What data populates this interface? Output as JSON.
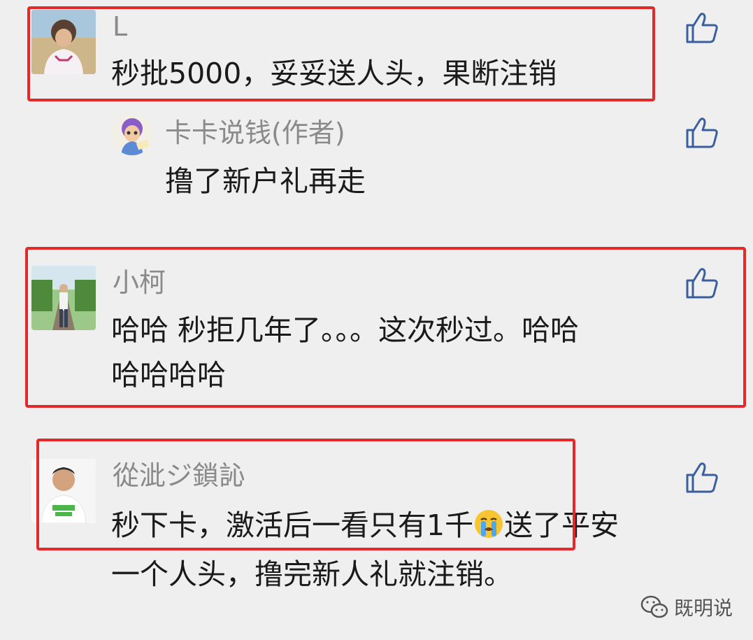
{
  "comments": [
    {
      "author": "L",
      "lines": [
        "秒批5000，妥妥送人头，果断注销"
      ],
      "highlighted": true
    },
    {
      "author": "卡卡说钱(作者)",
      "lines": [
        "撸了新户礼再走"
      ],
      "highlighted": false,
      "is_reply": true
    },
    {
      "author": "小柯",
      "lines": [
        "哈哈 秒拒几年了。。。这次秒过。哈哈",
        "哈哈哈哈"
      ],
      "highlighted": true
    },
    {
      "author": "從泚ジ鎖訫",
      "line1_before_emoji": "秒下卡，激活后一看只有1千",
      "line1_after_emoji": "送了平安",
      "line2": "一个人头，撸完新人礼就注销。",
      "emoji": "crying-face-icon",
      "highlighted": true
    }
  ],
  "icons": {
    "like": "thumbs-up-icon",
    "watermark": "wechat-icon"
  },
  "watermark": {
    "label": "既明说"
  },
  "colors": {
    "background": "#efeff0",
    "highlight": "#e32a2a",
    "author": "#8a8a8a",
    "text": "#1a1a1a"
  }
}
